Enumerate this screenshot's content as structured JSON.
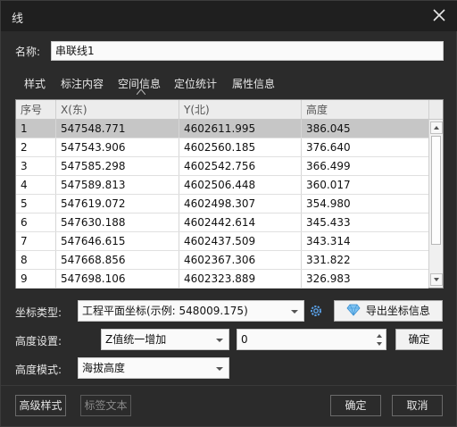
{
  "window": {
    "title": "线"
  },
  "name_label": "名称:",
  "name_value": "串联线1",
  "tabs": [
    "样式",
    "标注内容",
    "空间信息",
    "定位统计",
    "属性信息"
  ],
  "table": {
    "headers": [
      "序号",
      "X(东)",
      "Y(北)",
      "高度"
    ],
    "rows": [
      [
        "1",
        "547548.771",
        "4602611.995",
        "386.045"
      ],
      [
        "2",
        "547543.906",
        "4602560.185",
        "376.640"
      ],
      [
        "3",
        "547585.298",
        "4602542.756",
        "366.499"
      ],
      [
        "4",
        "547589.813",
        "4602506.448",
        "360.017"
      ],
      [
        "5",
        "547619.072",
        "4602498.307",
        "354.980"
      ],
      [
        "6",
        "547630.188",
        "4602442.614",
        "345.433"
      ],
      [
        "7",
        "547646.615",
        "4602437.509",
        "343.314"
      ],
      [
        "8",
        "547668.856",
        "4602367.306",
        "331.822"
      ],
      [
        "9",
        "547698.106",
        "4602323.889",
        "326.983"
      ]
    ],
    "selected_row": 0
  },
  "coord": {
    "label": "坐标类型:",
    "value": "工程平面坐标(示例: 548009.175)",
    "export_label": "导出坐标信息"
  },
  "height_setting": {
    "label": "高度设置:",
    "mode": "Z值统一增加",
    "amount": "0",
    "confirm_label": "确定"
  },
  "height_mode": {
    "label": "高度模式:",
    "value": "海拔高度"
  },
  "footer": {
    "advanced_style": "高级样式",
    "label_text": "标签文本",
    "ok": "确定",
    "cancel": "取消"
  }
}
